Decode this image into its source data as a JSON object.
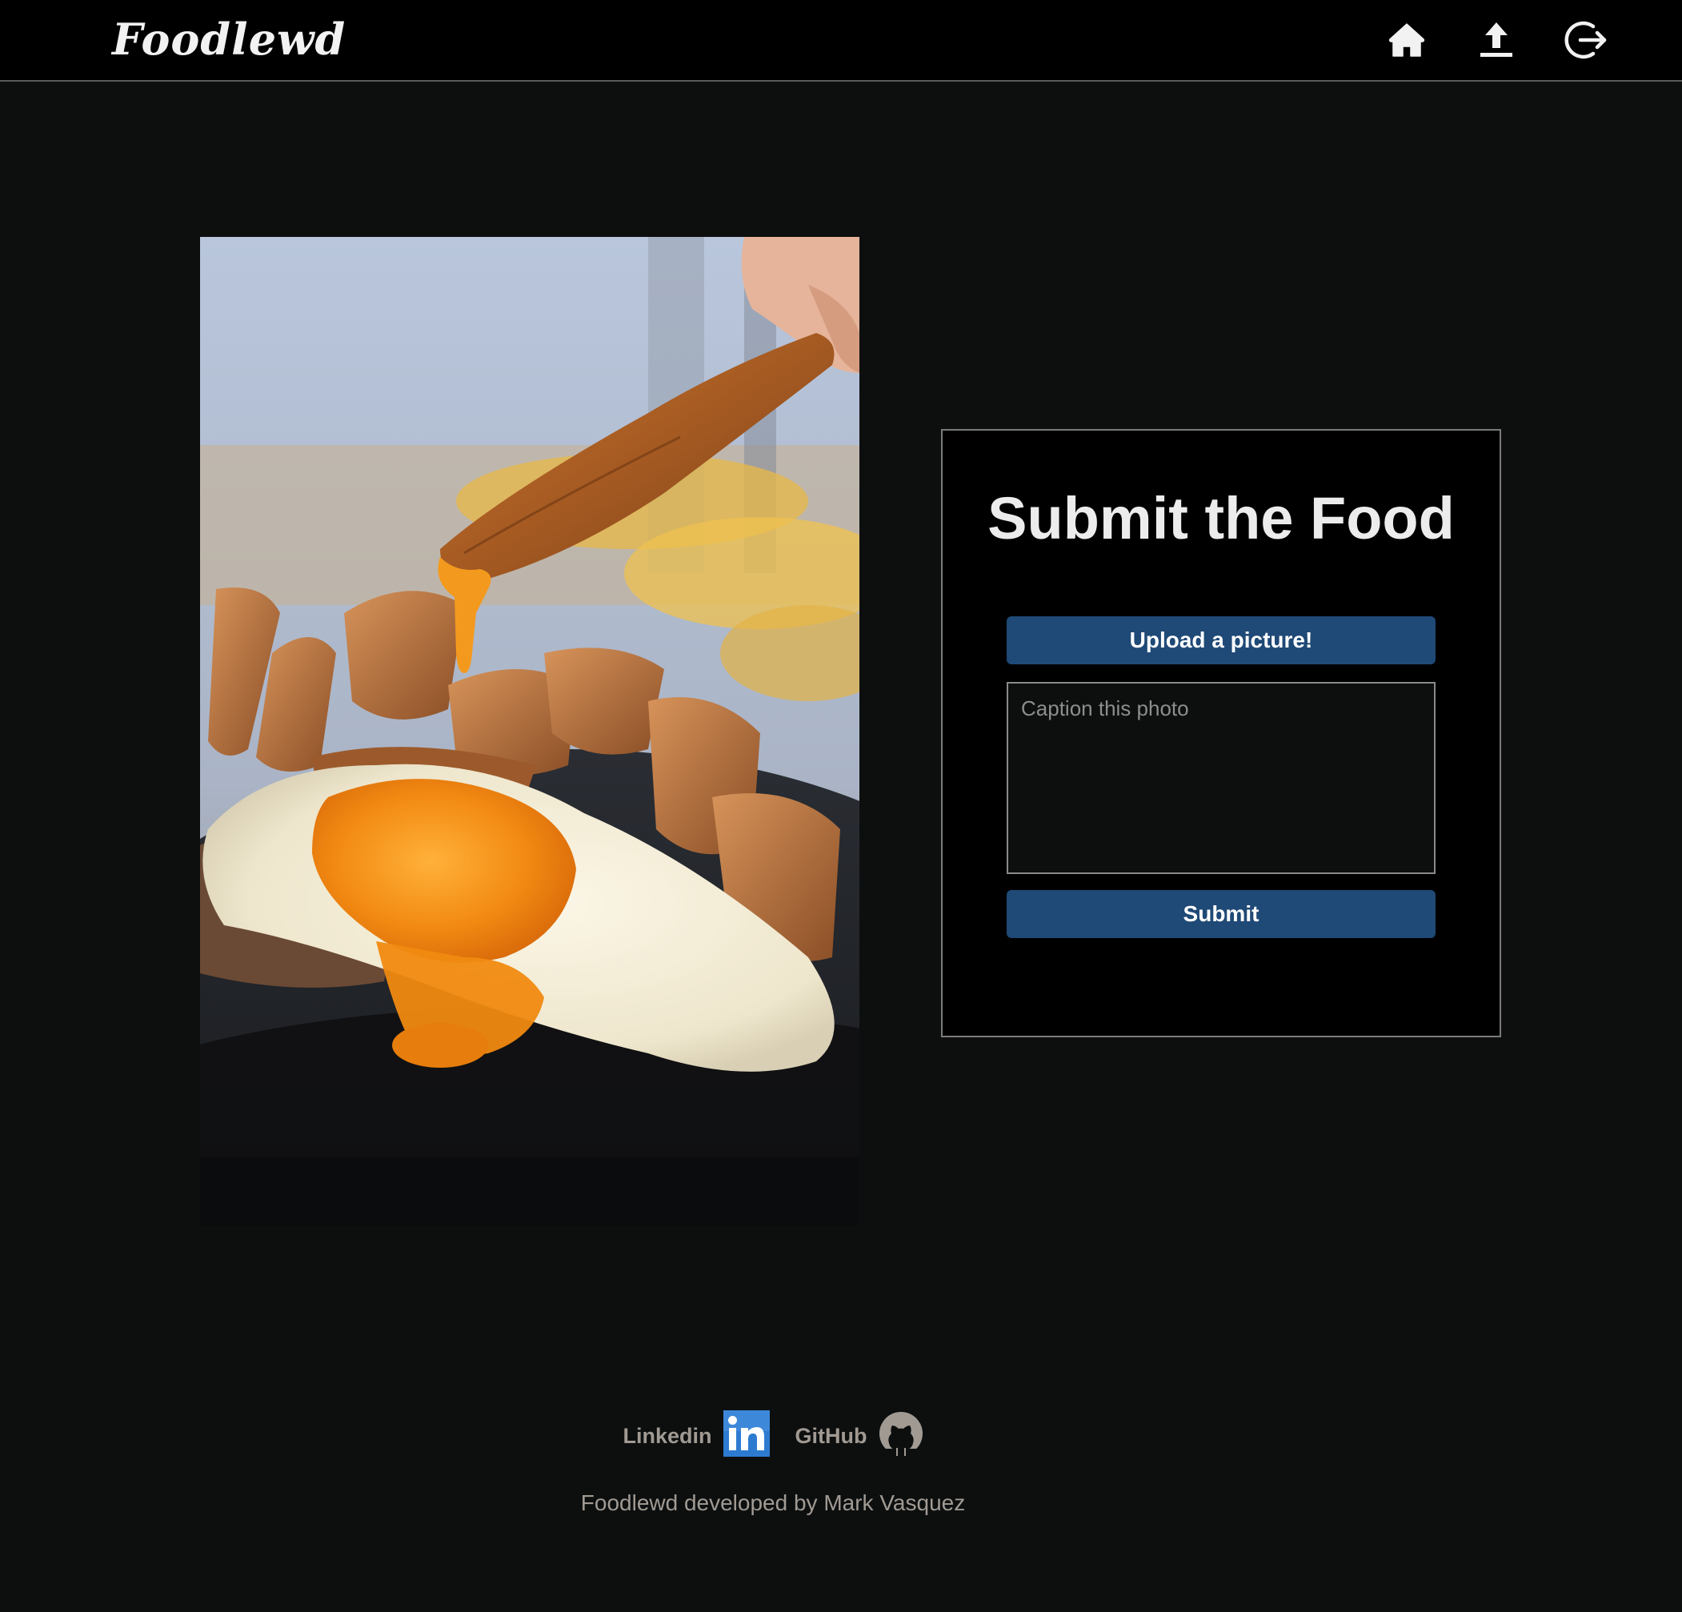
{
  "header": {
    "brand": "Foodlewd",
    "nav": [
      {
        "icon": "home-icon",
        "label": "Home"
      },
      {
        "icon": "upload-icon",
        "label": "Upload"
      },
      {
        "icon": "logout-icon",
        "label": "Log out"
      }
    ]
  },
  "photo": {
    "subject": "fried egg with potato wedges"
  },
  "form": {
    "title": "Submit the Food",
    "upload_label": "Upload a picture!",
    "caption_placeholder": "Caption this photo",
    "caption_value": "",
    "submit_label": "Submit"
  },
  "footer": {
    "links": [
      {
        "label": "Linkedin",
        "icon": "linkedin-icon"
      },
      {
        "label": "GitHub",
        "icon": "github-icon"
      }
    ],
    "credit": "Foodlewd developed by Mark Vasquez"
  },
  "colors": {
    "page_bg": "#0d0f0f",
    "header_bg": "#000000",
    "button_bg": "#1f4976",
    "footer_text": "#a09a93",
    "linkedin_blue": "#2d7bd1"
  }
}
